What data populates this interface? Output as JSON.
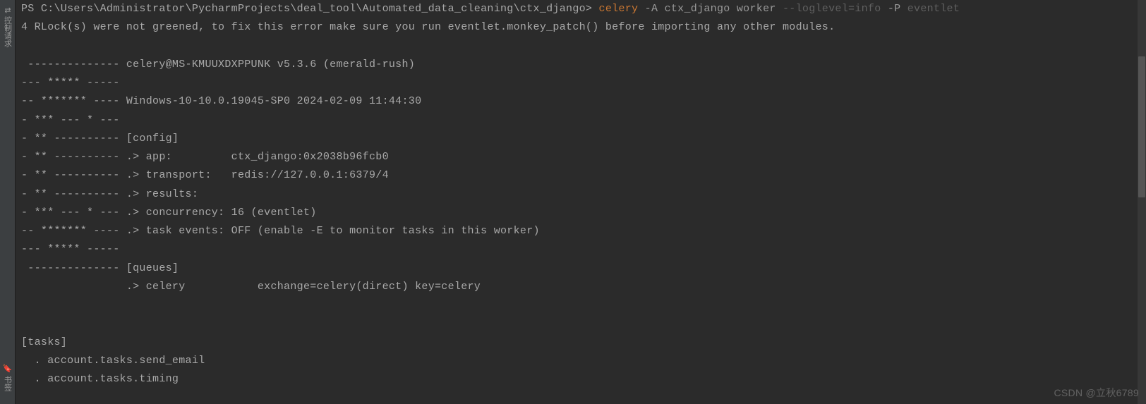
{
  "sidebar": {
    "tab1": "控制请求",
    "tab2": "书签"
  },
  "terminal": {
    "prompt_path": "PS C:\\Users\\Administrator\\PycharmProjects\\deal_tool\\Automated_data_cleaning\\ctx_django>",
    "cmd_celery": "celery",
    "cmd_args1": " -A ctx_django worker ",
    "cmd_flag1": "--loglevel=info",
    "cmd_args2": " -P ",
    "cmd_args3": "eventlet",
    "warning": "4 RLock(s) were not greened, to fix this error make sure you run eventlet.monkey_patch() before importing any other modules.",
    "blank": " ",
    "banner_header": " -------------- celery@MS-KMUUXDXPPUNK v5.3.6 (emerald-rush)",
    "banner_line1": "--- ***** -----",
    "banner_platform": "-- ******* ---- Windows-10-10.0.19045-SP0 2024-02-09 11:44:30",
    "banner_line2": "- *** --- * ---",
    "banner_config": "- ** ---------- [config]",
    "banner_app": "- ** ---------- .> app:         ctx_django:0x2038b96fcb0",
    "banner_transport": "- ** ---------- .> transport:   redis://127.0.0.1:6379/4",
    "banner_results": "- ** ---------- .> results:     ",
    "banner_concurrency": "- *** --- * --- .> concurrency: 16 (eventlet)",
    "banner_events": "-- ******* ---- .> task events: OFF (enable -E to monitor tasks in this worker)",
    "banner_line3": "--- ***** -----",
    "banner_queues": " -------------- [queues]",
    "banner_queue1": "                .> celery           exchange=celery(direct) key=celery",
    "blank2": " ",
    "blank3": " ",
    "tasks_header": "[tasks]",
    "task1": "  . account.tasks.send_email",
    "task2": "  . account.tasks.timing"
  },
  "watermark": "CSDN @立秋6789"
}
